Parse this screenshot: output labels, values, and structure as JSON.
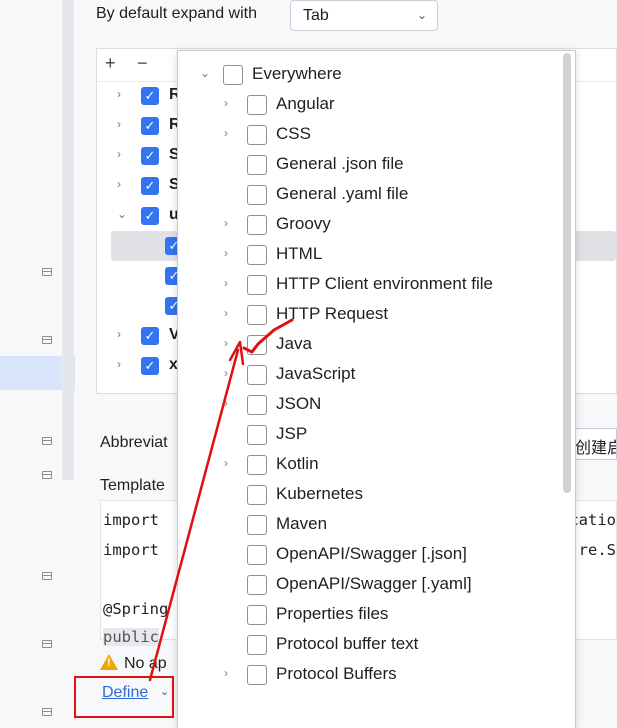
{
  "settings": {
    "expand_label": "By default expand with",
    "expand_value": "Tab",
    "abbreviation_label": "Abbreviat",
    "abbreviation_value": "创建启",
    "template_label": "Template",
    "warning_text": "No ap",
    "define_link": "Define"
  },
  "tree_toolbar": {
    "add": "+",
    "remove": "−"
  },
  "tree_rows": [
    {
      "label": "R",
      "checked": true,
      "expandable": true
    },
    {
      "label": "R",
      "checked": true,
      "expandable": true
    },
    {
      "label": "S",
      "checked": true,
      "expandable": true
    },
    {
      "label": "S",
      "checked": true,
      "expandable": true
    },
    {
      "label": "u",
      "checked": true,
      "expandable": true,
      "expanded": true
    },
    {
      "label": "",
      "checked": true,
      "selected": true
    },
    {
      "label": "",
      "checked": true
    },
    {
      "label": "",
      "checked": true
    },
    {
      "label": "V",
      "checked": true,
      "expandable": true
    },
    {
      "label": "x",
      "checked": true,
      "expandable": true
    }
  ],
  "code": {
    "line1": "import",
    "line1_right": "catio",
    "line2": "import",
    "line2_right": "re.S",
    "line3": "@Spring",
    "line4": "public"
  },
  "context_popup": {
    "items": [
      {
        "label": "Everywhere",
        "expandable": true,
        "expanded": true,
        "level": 0
      },
      {
        "label": "Angular",
        "expandable": true,
        "level": 1
      },
      {
        "label": "CSS",
        "expandable": true,
        "level": 1
      },
      {
        "label": "General .json file",
        "expandable": false,
        "level": 1
      },
      {
        "label": "General .yaml file",
        "expandable": false,
        "level": 1
      },
      {
        "label": "Groovy",
        "expandable": true,
        "level": 1
      },
      {
        "label": "HTML",
        "expandable": true,
        "level": 1
      },
      {
        "label": "HTTP Client environment file",
        "expandable": true,
        "level": 1
      },
      {
        "label": "HTTP Request",
        "expandable": true,
        "level": 1
      },
      {
        "label": "Java",
        "expandable": true,
        "level": 1
      },
      {
        "label": "JavaScript",
        "expandable": true,
        "level": 1
      },
      {
        "label": "JSON",
        "expandable": true,
        "level": 1
      },
      {
        "label": "JSP",
        "expandable": false,
        "level": 1
      },
      {
        "label": "Kotlin",
        "expandable": true,
        "level": 1
      },
      {
        "label": "Kubernetes",
        "expandable": false,
        "level": 1
      },
      {
        "label": "Maven",
        "expandable": false,
        "level": 1
      },
      {
        "label": "OpenAPI/Swagger [.json]",
        "expandable": false,
        "level": 1
      },
      {
        "label": "OpenAPI/Swagger [.yaml]",
        "expandable": false,
        "level": 1
      },
      {
        "label": "Properties files",
        "expandable": false,
        "level": 1
      },
      {
        "label": "Protocol buffer text",
        "expandable": false,
        "level": 1
      },
      {
        "label": "Protocol Buffers",
        "expandable": true,
        "level": 1
      }
    ]
  },
  "colors": {
    "accent": "#3574f0",
    "annotation": "#e01010",
    "link": "#2f6bd6"
  }
}
